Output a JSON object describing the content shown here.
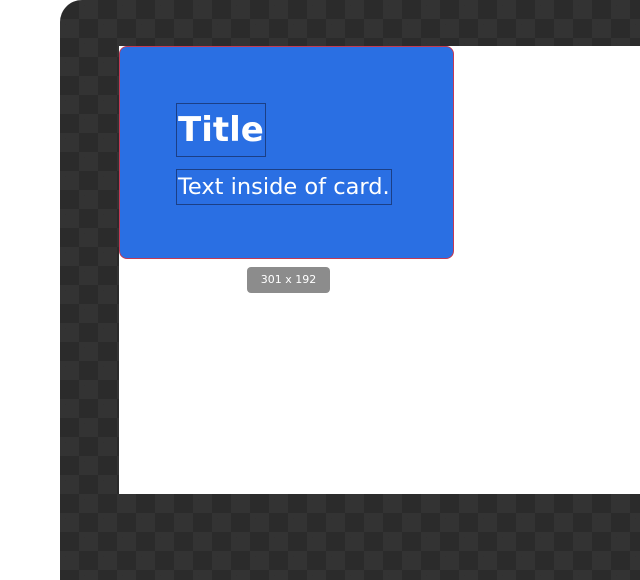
{
  "card": {
    "title": "Title",
    "text": "Text inside of card."
  },
  "selection": {
    "size_label": "301 x 192"
  },
  "colors": {
    "card_background": "#2a6fe3",
    "selection_outline": "#c23a55",
    "canvas_checker_dark": "#2b2b2b",
    "canvas_checker_light": "#333333",
    "tooltip_background": "#8c8c8c"
  }
}
